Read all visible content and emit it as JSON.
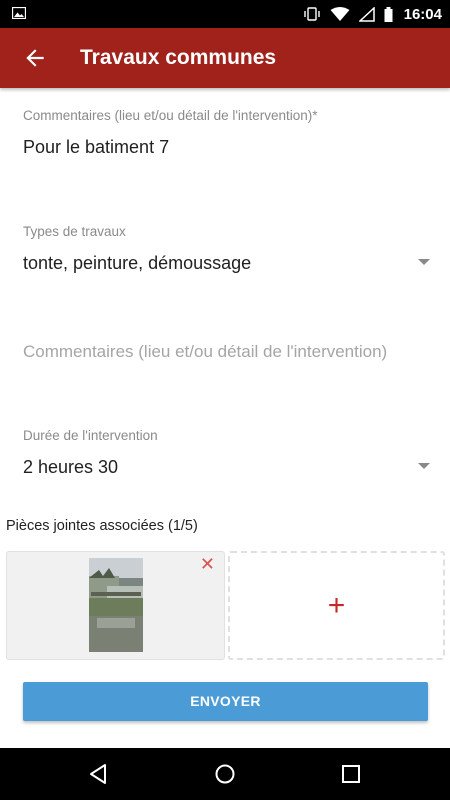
{
  "status_bar": {
    "time": "16:04",
    "icons": [
      "image-icon",
      "vibrate-icon",
      "wifi-icon",
      "signal-icon",
      "battery-icon"
    ]
  },
  "app_bar": {
    "title": "Travaux communes",
    "back_icon": "arrow-left-icon",
    "color": "#a0221b"
  },
  "form": {
    "comment_field": {
      "label": "Commentaires (lieu et/ou détail de l'intervention)*",
      "value": "Pour le batiment 7"
    },
    "work_types": {
      "label": "Types de travaux",
      "value": "tonte, peinture, démoussage"
    },
    "comment_field_2": {
      "placeholder": "Commentaires (lieu et/ou détail de l'intervention)"
    },
    "duration": {
      "label": "Durée de l'intervention",
      "value": "2 heures 30"
    }
  },
  "attachments": {
    "title": "Pièces jointes associées (1/5)",
    "remove_symbol": "✕",
    "add_symbol": "+"
  },
  "submit_button": {
    "label": "ENVOYER",
    "color": "#4a9bd6"
  }
}
